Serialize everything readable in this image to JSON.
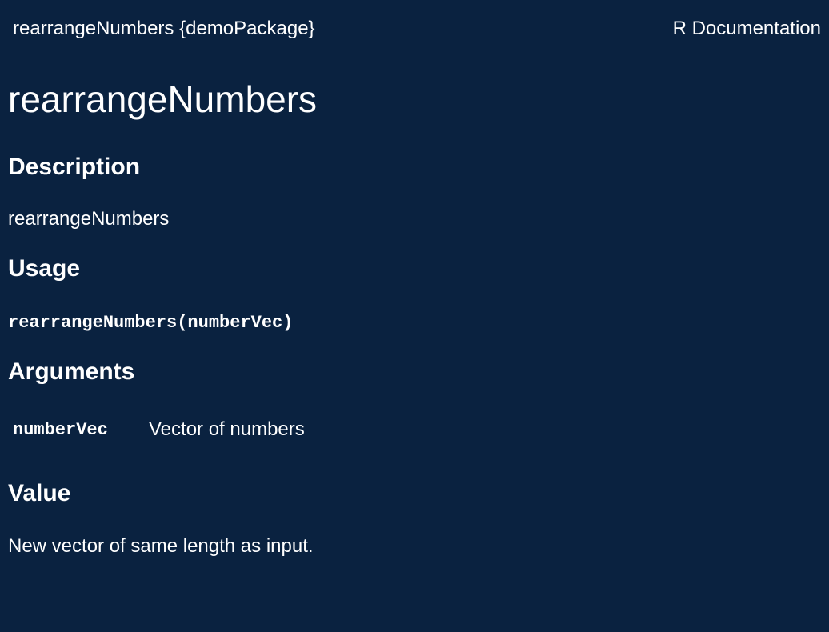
{
  "header": {
    "topic_package": "rearrangeNumbers {demoPackage}",
    "doc_label": "R Documentation"
  },
  "page_title": "rearrangeNumbers",
  "sections": {
    "description": {
      "heading": "Description",
      "text": "rearrangeNumbers"
    },
    "usage": {
      "heading": "Usage",
      "code": "rearrangeNumbers(numberVec)"
    },
    "arguments": {
      "heading": "Arguments",
      "items": [
        {
          "name": "numberVec",
          "description": "Vector of numbers"
        }
      ]
    },
    "value": {
      "heading": "Value",
      "text": "New vector of same length as input."
    }
  },
  "colors": {
    "background": "#0a2240",
    "text": "#ffffff"
  }
}
